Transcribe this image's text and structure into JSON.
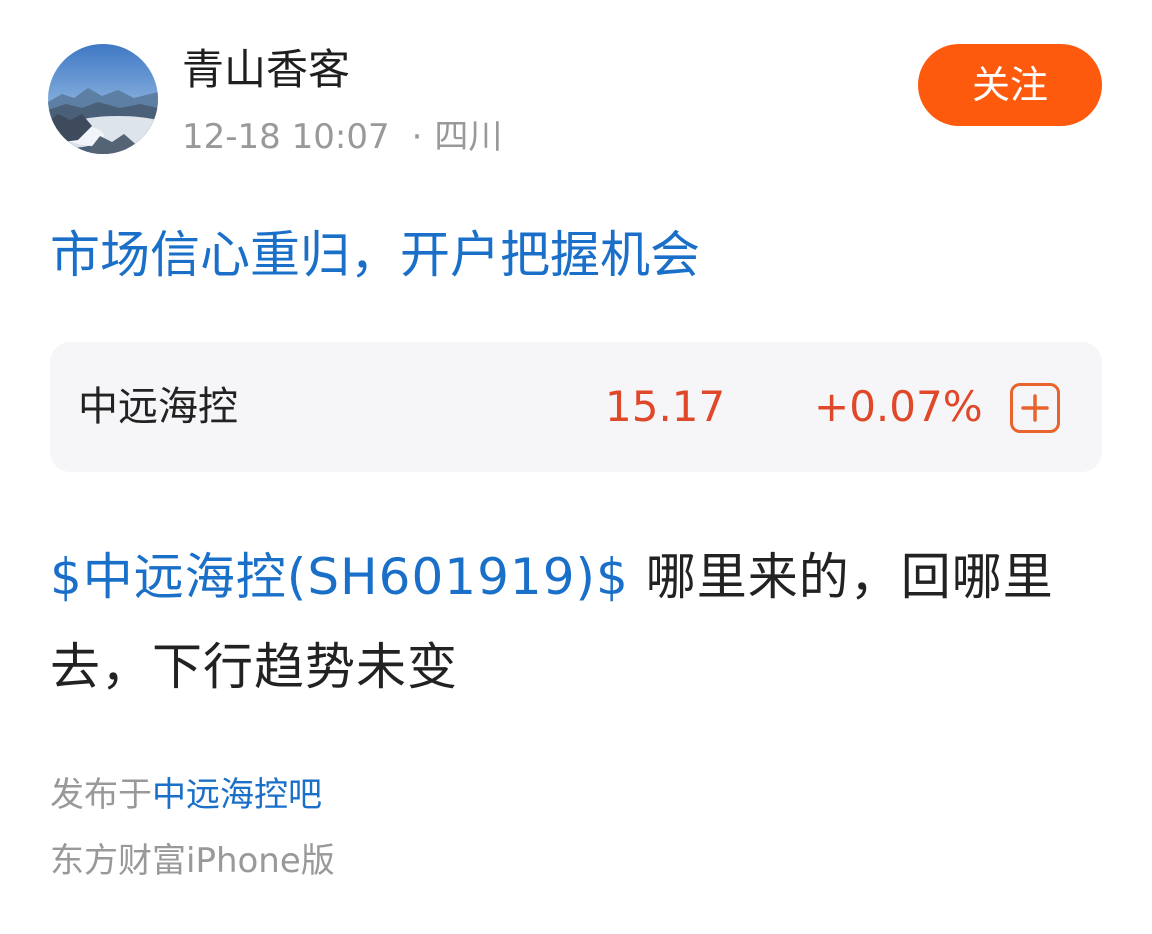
{
  "author": {
    "name": "青山香客",
    "timestamp": "12-18 10:07",
    "separator": "·",
    "location": "四川",
    "follow_label": "关注"
  },
  "post": {
    "title": "市场信心重归，开户把握机会",
    "stock_link_text": "$中远海控(SH601919)$",
    "body_text": " 哪里来的，回哪里去，下行趋势未变"
  },
  "stock_card": {
    "name": "中远海控",
    "price": "15.17",
    "change": "+0.07%",
    "add_icon": "plus-square-icon"
  },
  "footer": {
    "published_prefix": "发布于",
    "forum_name": "中远海控吧",
    "source": "东方财富iPhone版"
  },
  "colors": {
    "accent_blue": "#1a6fc8",
    "follow_orange": "#fe5a0d",
    "price_red": "#e0482a",
    "card_background": "#f6f6f8",
    "muted_text": "#999999"
  }
}
